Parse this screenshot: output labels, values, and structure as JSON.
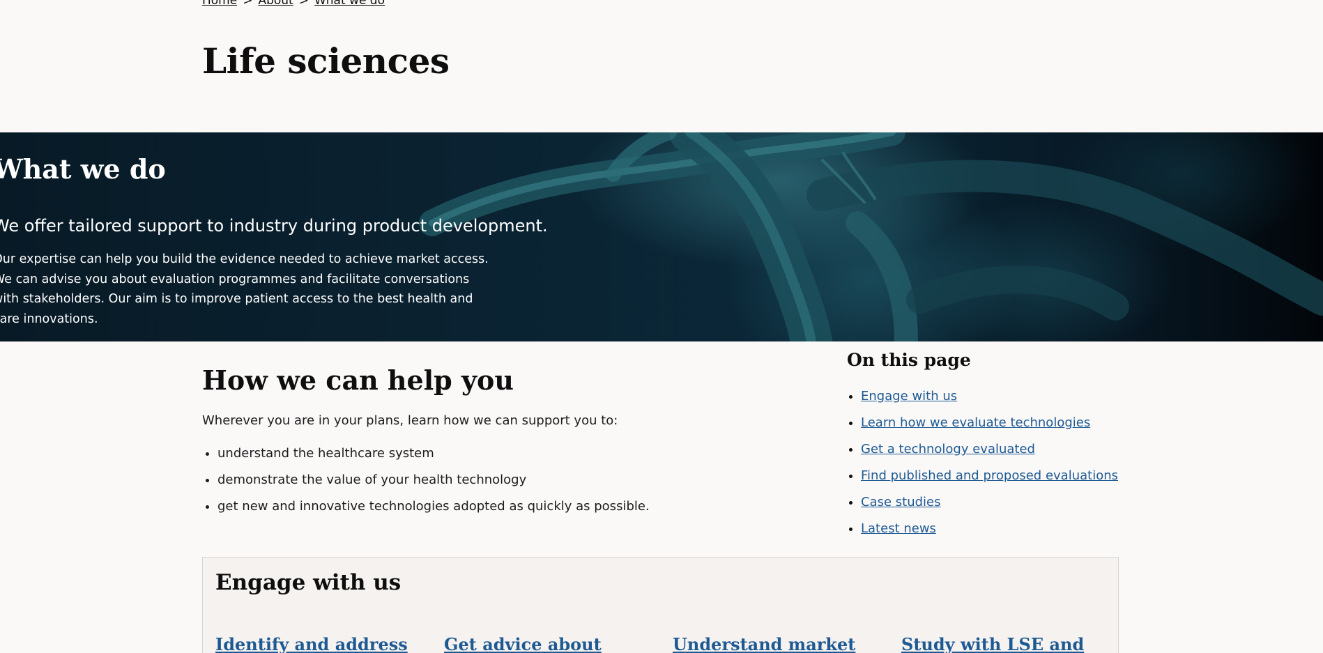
{
  "breadcrumb": {
    "items": [
      {
        "label": "Home"
      },
      {
        "label": "About"
      },
      {
        "label": "What we do"
      }
    ],
    "separator": ">"
  },
  "page": {
    "title": "Life sciences"
  },
  "hero": {
    "title": "What we do",
    "lead": "We offer tailored support to industry during product development.",
    "body": "Our expertise can help you build the evidence needed to achieve market access. We can advise you about evaluation programmes and facilitate conversations with stakeholders. Our aim is to improve patient access to the best health and care innovations."
  },
  "help": {
    "title": "How we can help you",
    "intro": "Wherever you are in your plans, learn how we can support you to:",
    "items": [
      "understand the healthcare system",
      "demonstrate the value of your health technology",
      "get new and innovative technologies adopted as quickly as possible."
    ]
  },
  "on_this_page": {
    "title": "On this page",
    "links": [
      "Engage with us",
      "Learn how we evaluate technologies",
      "Get a technology evaluated",
      "Find published and proposed evaluations",
      "Case studies",
      "Latest news"
    ]
  },
  "engage": {
    "title": "Engage with us",
    "cards": [
      "Identify and address",
      "Get advice about",
      "Understand market",
      "Study with LSE and"
    ]
  },
  "colors": {
    "background": "#fbf9f8",
    "link": "#1d5a93",
    "hero_bg": "#0a2231",
    "panel_bg": "#f6f2ef"
  }
}
